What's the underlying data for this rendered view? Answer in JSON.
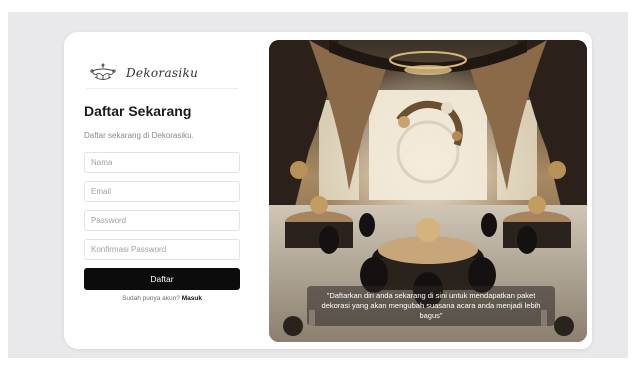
{
  "brand": {
    "name": "Dekorasiku",
    "logo": "chandelier-logo-icon"
  },
  "form": {
    "title": "Daftar Sekarang",
    "subtitle": "Daftar sekarang di Dekorasiku.",
    "fields": [
      {
        "placeholder": "Nama",
        "value": ""
      },
      {
        "placeholder": "Email",
        "value": ""
      },
      {
        "placeholder": "Password",
        "value": ""
      },
      {
        "placeholder": "Konfirmasi Password",
        "value": ""
      }
    ],
    "submit_label": "Daftar",
    "login_prompt": "Sudah punya akun?",
    "login_link": "Masuk"
  },
  "hero": {
    "caption": "\"Daftarkan diri anda sekarang di sini untuk mendapatkan paket dekorasi yang akan mengubah suasana acara anda menjadi lebih bagus\""
  },
  "colors": {
    "button": "#0c0c0c",
    "background": "#e9e9ec",
    "card": "#ffffff"
  }
}
